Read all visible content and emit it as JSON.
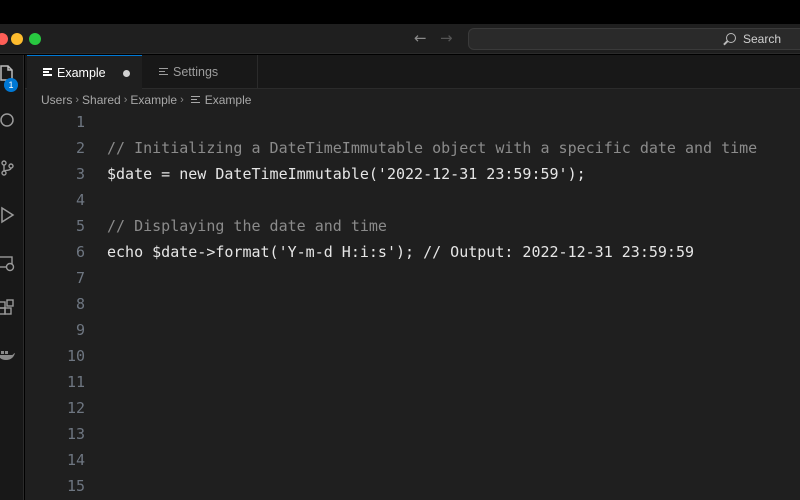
{
  "window": {
    "search_label": "Search"
  },
  "activity_bar": {
    "explorer_badge": "1",
    "icons": [
      "files-icon",
      "search-icon",
      "source-control-icon",
      "run-debug-icon",
      "remote-explorer-icon",
      "extensions-icon",
      "docker-icon"
    ]
  },
  "tabs": [
    {
      "label": "Example",
      "active": true,
      "modified": true
    },
    {
      "label": "Settings",
      "active": false,
      "modified": false
    }
  ],
  "breadcrumb": [
    "Users",
    "Shared",
    "Example",
    "Example"
  ],
  "editor": {
    "line_numbers": [
      "1",
      "2",
      "3",
      "4",
      "5",
      "6",
      "7",
      "8",
      "9",
      "10",
      "11",
      "12",
      "13",
      "14",
      "15"
    ],
    "lines": [
      "",
      "// Initializing a DateTimeImmutable object with a specific date and time",
      "$date = new DateTimeImmutable('2022-12-31 23:59:59');",
      "",
      "// Displaying the date and time",
      "echo $date->format('Y-m-d H:i:s'); // Output: 2022-12-31 23:59:59",
      "",
      "",
      "",
      "",
      "",
      "",
      "",
      "",
      ""
    ]
  },
  "colors": {
    "accent": "#0078d4",
    "editor_bg": "#1f1f1f",
    "comment": "#8b8b8b"
  }
}
